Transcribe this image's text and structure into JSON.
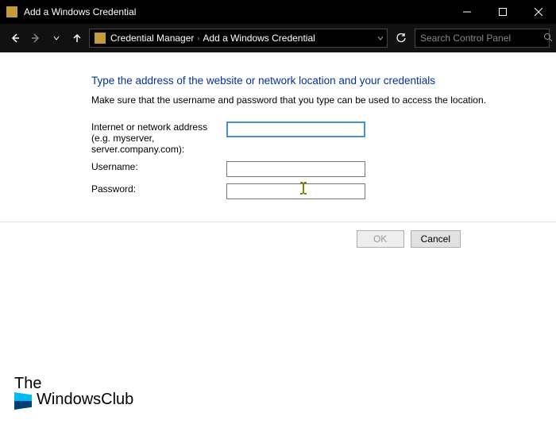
{
  "titlebar": {
    "title": "Add a Windows Credential"
  },
  "navbar": {
    "breadcrumb": {
      "part1": "Credential Manager",
      "part2": "Add a Windows Credential"
    },
    "search_placeholder": "Search Control Panel"
  },
  "page": {
    "heading": "Type the address of the website or network location and your credentials",
    "instruction": "Make sure that the username and password that you type can be used to access the location.",
    "fields": {
      "address": {
        "label_line1": "Internet or network address",
        "label_line2": "(e.g. myserver, server.company.com):",
        "value": ""
      },
      "username": {
        "label": "Username:",
        "value": ""
      },
      "password": {
        "label": "Password:",
        "value": ""
      }
    },
    "buttons": {
      "ok": "OK",
      "cancel": "Cancel"
    }
  },
  "watermark": {
    "line1": "The",
    "line2": "WindowsClub"
  }
}
